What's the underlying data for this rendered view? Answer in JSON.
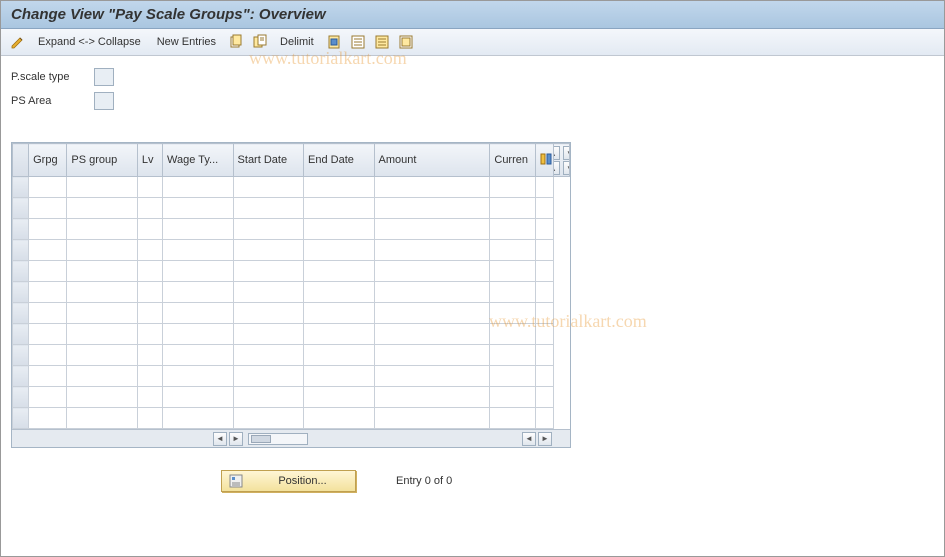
{
  "title": "Change View \"Pay Scale Groups\": Overview",
  "toolbar": {
    "expand_collapse": "Expand <-> Collapse",
    "new_entries": "New Entries",
    "delimit": "Delimit"
  },
  "form": {
    "pscale_type": {
      "label": "P.scale type",
      "value": ""
    },
    "ps_area": {
      "label": "PS Area",
      "value": ""
    }
  },
  "table": {
    "columns": [
      "Grpg",
      "PS group",
      "Lv",
      "Wage Ty...",
      "Start Date",
      "End Date",
      "Amount",
      "Curren"
    ],
    "rows": [
      {
        "grpg": "",
        "psgroup": "",
        "lv": "",
        "wagetype": "",
        "startdate": "",
        "enddate": "",
        "amount": "",
        "curren": ""
      },
      {
        "grpg": "",
        "psgroup": "",
        "lv": "",
        "wagetype": "",
        "startdate": "",
        "enddate": "",
        "amount": "",
        "curren": ""
      },
      {
        "grpg": "",
        "psgroup": "",
        "lv": "",
        "wagetype": "",
        "startdate": "",
        "enddate": "",
        "amount": "",
        "curren": ""
      },
      {
        "grpg": "",
        "psgroup": "",
        "lv": "",
        "wagetype": "",
        "startdate": "",
        "enddate": "",
        "amount": "",
        "curren": ""
      },
      {
        "grpg": "",
        "psgroup": "",
        "lv": "",
        "wagetype": "",
        "startdate": "",
        "enddate": "",
        "amount": "",
        "curren": ""
      },
      {
        "grpg": "",
        "psgroup": "",
        "lv": "",
        "wagetype": "",
        "startdate": "",
        "enddate": "",
        "amount": "",
        "curren": ""
      },
      {
        "grpg": "",
        "psgroup": "",
        "lv": "",
        "wagetype": "",
        "startdate": "",
        "enddate": "",
        "amount": "",
        "curren": ""
      },
      {
        "grpg": "",
        "psgroup": "",
        "lv": "",
        "wagetype": "",
        "startdate": "",
        "enddate": "",
        "amount": "",
        "curren": ""
      },
      {
        "grpg": "",
        "psgroup": "",
        "lv": "",
        "wagetype": "",
        "startdate": "",
        "enddate": "",
        "amount": "",
        "curren": ""
      },
      {
        "grpg": "",
        "psgroup": "",
        "lv": "",
        "wagetype": "",
        "startdate": "",
        "enddate": "",
        "amount": "",
        "curren": ""
      },
      {
        "grpg": "",
        "psgroup": "",
        "lv": "",
        "wagetype": "",
        "startdate": "",
        "enddate": "",
        "amount": "",
        "curren": ""
      },
      {
        "grpg": "",
        "psgroup": "",
        "lv": "",
        "wagetype": "",
        "startdate": "",
        "enddate": "",
        "amount": "",
        "curren": ""
      }
    ]
  },
  "footer": {
    "position_button": "Position...",
    "entry_text": "Entry 0 of 0"
  },
  "icons": {
    "up": "▲",
    "down": "▼",
    "left": "◄",
    "right": "►"
  },
  "watermark": "www.tutorialkart.com"
}
